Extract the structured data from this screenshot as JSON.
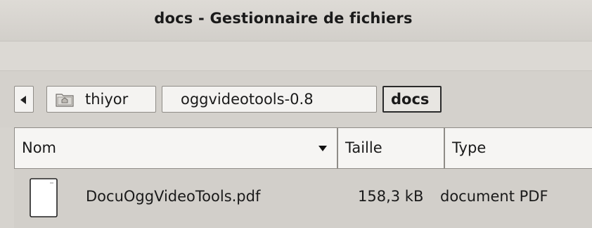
{
  "window": {
    "title": "docs - Gestionnaire de fichiers"
  },
  "pathbar": {
    "crumbs": [
      "thiyor",
      "oggvideotools-0.8",
      "docs"
    ],
    "active_index": 2
  },
  "columns": {
    "name": "Nom",
    "size": "Taille",
    "type": "Type",
    "sort_column": "Nom",
    "sort_direction": "descending"
  },
  "files": [
    {
      "name": "DocuOggVideoTools.pdf",
      "size": "158,3 kB",
      "type": "document PDF",
      "icon": "pdf-document-icon"
    }
  ],
  "colors": {
    "window_bg": "#d6d3ce",
    "button_bg": "#f4f3f1",
    "active_crumb_border": "#2a2a2a"
  }
}
